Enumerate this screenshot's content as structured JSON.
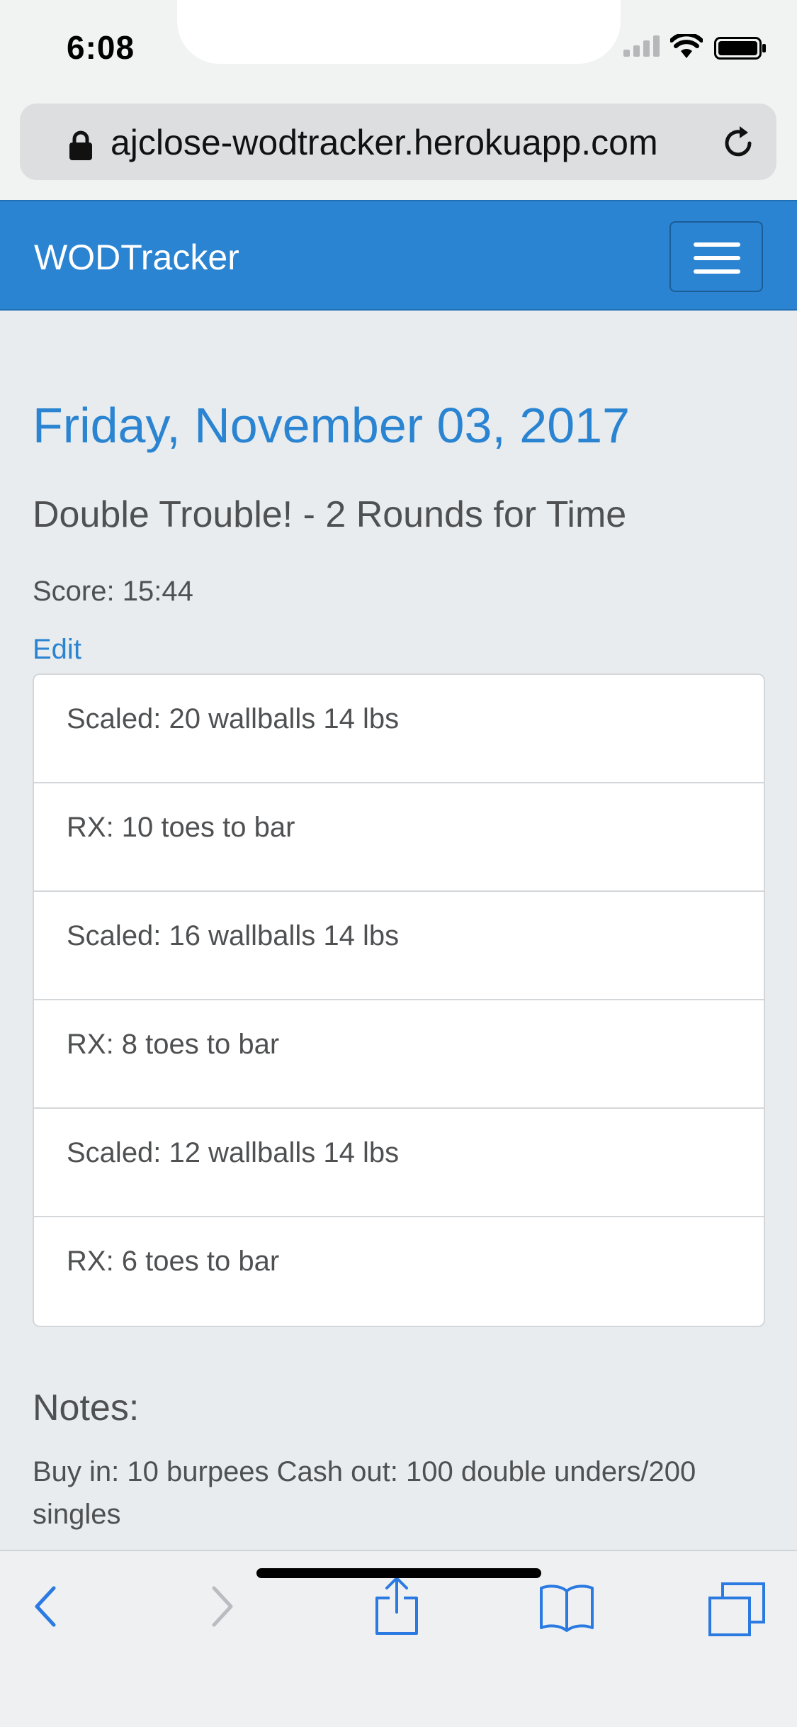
{
  "status_bar": {
    "time": "6:08",
    "icons": [
      "signal-icon",
      "wifi-icon",
      "battery-icon"
    ]
  },
  "browser": {
    "url": "ajclose-wodtracker.herokuapp.com",
    "icons": [
      "lock-icon",
      "reload-icon"
    ]
  },
  "navbar": {
    "brand": "WODTracker",
    "menu_icon": "hamburger-menu-icon"
  },
  "workout": {
    "date": "Friday, November 03, 2017",
    "title": "Double Trouble! - 2 Rounds for Time",
    "score": "Score: 15:44",
    "edit_label": "Edit",
    "movements": [
      "Scaled: 20 wallballs 14 lbs",
      "RX: 10 toes to bar",
      "Scaled: 16 wallballs 14 lbs",
      "RX: 8 toes to bar",
      "Scaled: 12 wallballs 14 lbs",
      "RX: 6 toes to bar"
    ],
    "notes_heading": "Notes:",
    "notes": "Buy in: 10 burpees Cash out: 100 double unders/200 singles"
  },
  "toolbar": {
    "icons": [
      "back-icon",
      "forward-icon",
      "share-icon",
      "bookmarks-icon",
      "tabs-icon"
    ]
  },
  "colors": {
    "accent": "#2a84d2",
    "background": "#e8ecee",
    "text": "#4f5052"
  }
}
